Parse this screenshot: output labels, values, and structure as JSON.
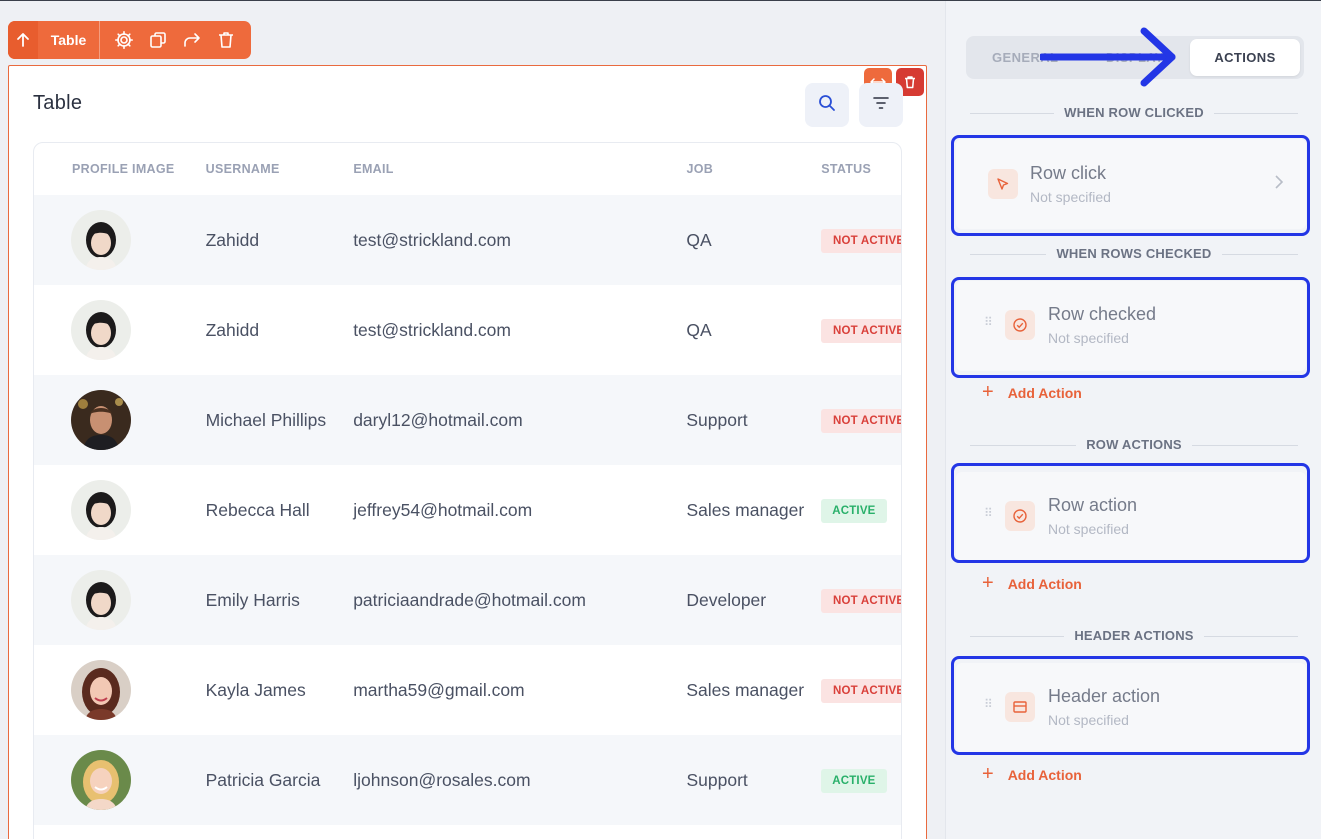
{
  "toolbar": {
    "label": "Table",
    "icons": [
      "arrow-up-icon",
      "gear-icon",
      "copy-icon",
      "share-icon",
      "trash-icon"
    ]
  },
  "table": {
    "title": "Table",
    "columns": [
      "PROFILE IMAGE",
      "USERNAME",
      "EMAIL",
      "JOB",
      "STATUS"
    ],
    "rows": [
      {
        "username": "Zahidd",
        "email": "test@strickland.com",
        "job": "QA",
        "status": "NOT ACTIVE"
      },
      {
        "username": "Zahidd",
        "email": "test@strickland.com",
        "job": "QA",
        "status": "NOT ACTIVE"
      },
      {
        "username": "Michael Phillips",
        "email": "daryl12@hotmail.com",
        "job": "Support",
        "status": "NOT ACTIVE"
      },
      {
        "username": "Rebecca Hall",
        "email": "jeffrey54@hotmail.com",
        "job": "Sales manager",
        "status": "ACTIVE"
      },
      {
        "username": "Emily Harris",
        "email": "patriciaandrade@hotmail.com",
        "job": "Developer",
        "status": "NOT ACTIVE"
      },
      {
        "username": "Kayla James",
        "email": "martha59@gmail.com",
        "job": "Sales manager",
        "status": "NOT ACTIVE"
      },
      {
        "username": "Patricia Garcia",
        "email": "ljohnson@rosales.com",
        "job": "Support",
        "status": "ACTIVE"
      }
    ]
  },
  "panel": {
    "tabs": {
      "general": "GENERAL",
      "display": "DISPLAY",
      "actions": "ACTIONS"
    },
    "sections": {
      "row_clicked": "WHEN ROW CLICKED",
      "rows_checked": "WHEN ROWS CHECKED",
      "row_actions": "ROW ACTIONS",
      "header_actions": "HEADER ACTIONS"
    },
    "cards": {
      "row_click": {
        "title": "Row click",
        "sub": "Not specified"
      },
      "row_checked": {
        "title": "Row checked",
        "sub": "Not specified"
      },
      "row_action": {
        "title": "Row action",
        "sub": "Not specified"
      },
      "header_action": {
        "title": "Header action",
        "sub": "Not specified"
      }
    },
    "add_action": "Add Action"
  },
  "colors": {
    "accent": "#ee6a3c",
    "highlight": "#2336e6",
    "inactive_bg": "#fbe3e2",
    "inactive_text": "#d9403a",
    "active_bg": "#dff5e8",
    "active_text": "#29b06a"
  }
}
